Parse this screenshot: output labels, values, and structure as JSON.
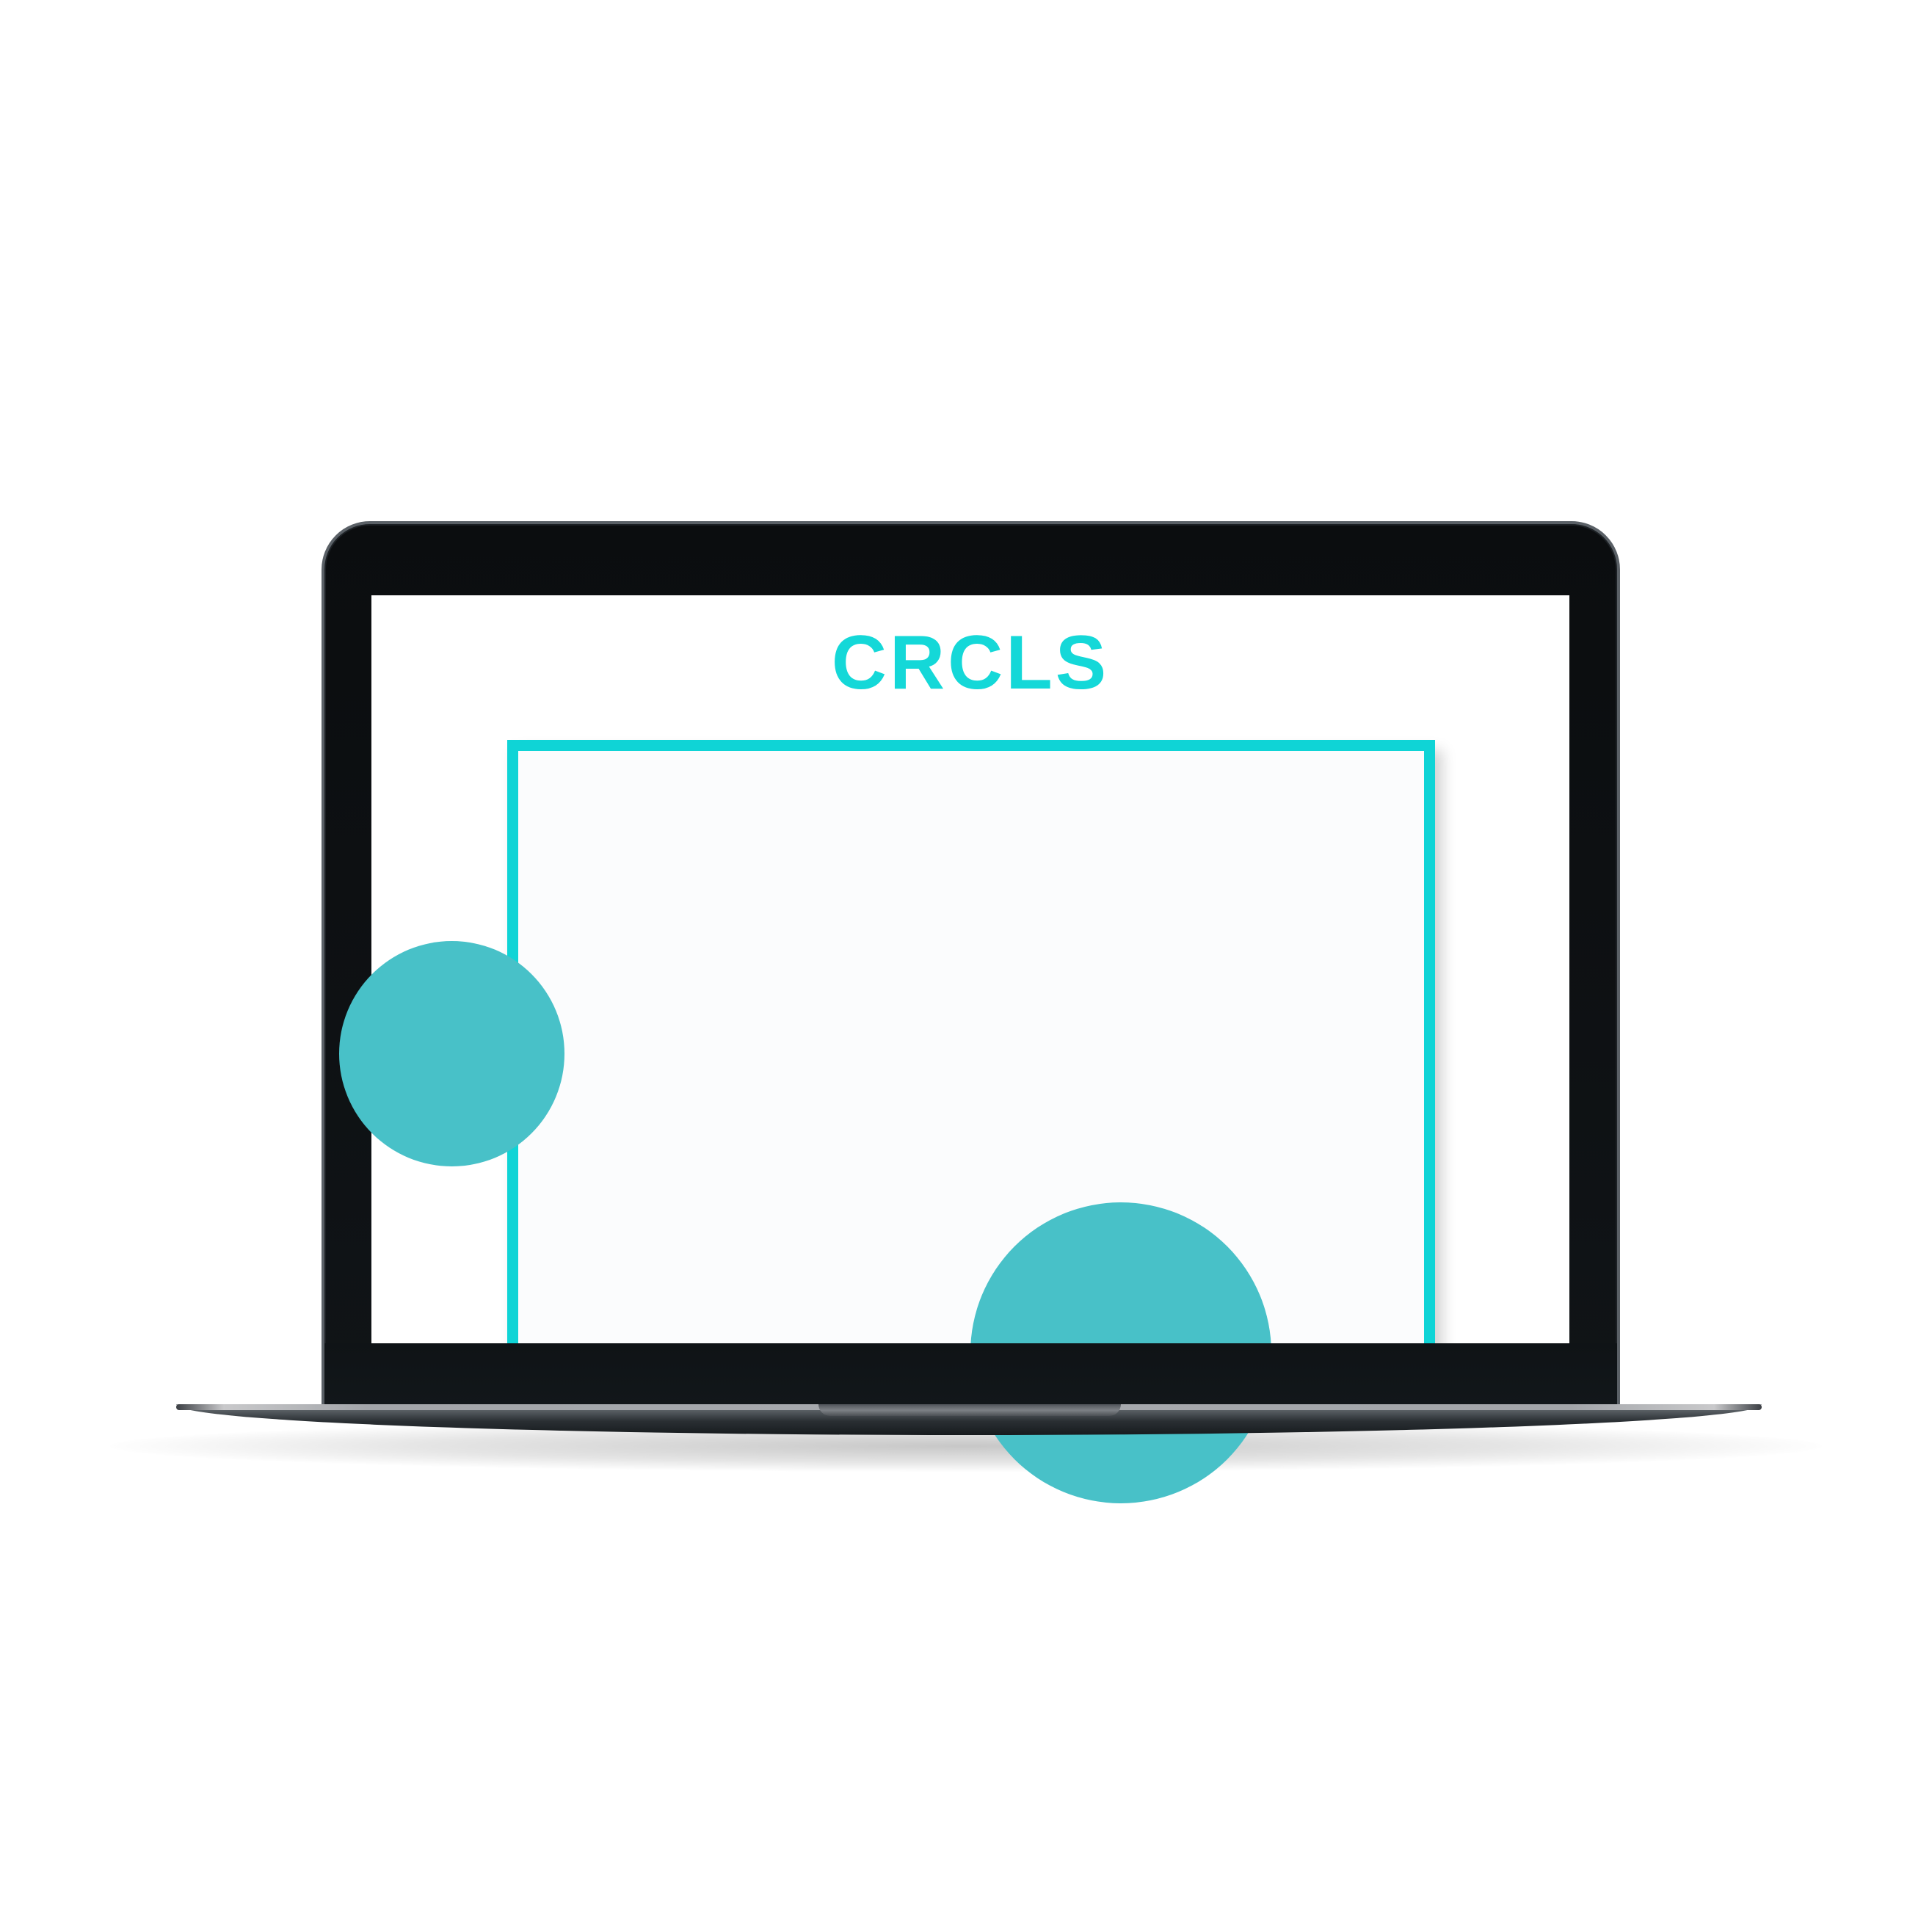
{
  "app": {
    "logo_text": "CRCLS"
  },
  "device": {
    "type": "laptop-mockup",
    "bezel_color": "#0b0d0f",
    "screen_color": "#ffffff"
  },
  "canvas": {
    "frame_color": "#0fd4d6",
    "background": "#fbfcfd"
  },
  "shapes": [
    {
      "kind": "circle",
      "color": "#48c1c8"
    },
    {
      "kind": "circle",
      "color": "#48c1c8"
    }
  ]
}
